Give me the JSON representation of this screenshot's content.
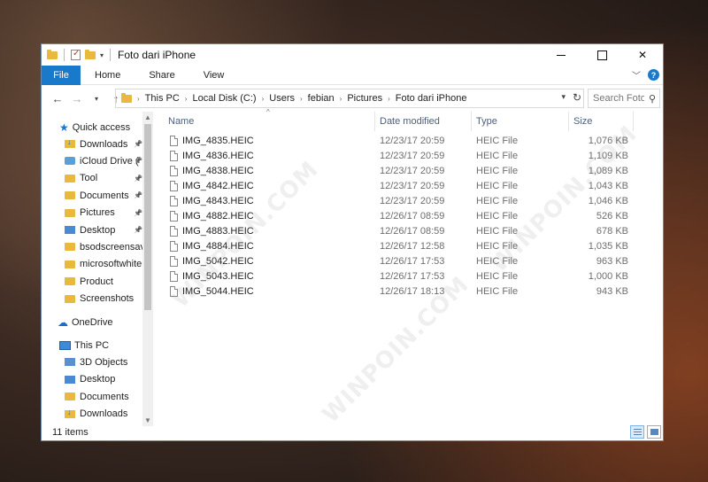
{
  "window": {
    "title": "Foto dari iPhone",
    "quick_access_dropdown": "▾"
  },
  "ribbon": {
    "tabs": [
      "File",
      "Home",
      "Share",
      "View"
    ]
  },
  "address": {
    "crumbs": [
      "This PC",
      "Local Disk (C:)",
      "Users",
      "febian",
      "Pictures",
      "Foto dari iPhone"
    ],
    "search_placeholder": "Search Foto..."
  },
  "nav": {
    "quick_access": "Quick access",
    "quick_items": [
      {
        "label": "Downloads",
        "icon": "downloads-folder-icon",
        "pinned": true
      },
      {
        "label": "iCloud Drive (",
        "icon": "icloud-drive-icon",
        "pinned": true
      },
      {
        "label": "Tool",
        "icon": "folder-icon",
        "pinned": true
      },
      {
        "label": "Documents",
        "icon": "documents-folder-icon",
        "pinned": true
      },
      {
        "label": "Pictures",
        "icon": "pictures-folder-icon",
        "pinned": true
      },
      {
        "label": "Desktop",
        "icon": "desktop-folder-icon",
        "pinned": true
      },
      {
        "label": "bsodscreensaver",
        "icon": "folder-icon",
        "pinned": false
      },
      {
        "label": "microsoftwhiteb",
        "icon": "folder-icon",
        "pinned": false
      },
      {
        "label": "Product",
        "icon": "folder-icon",
        "pinned": false
      },
      {
        "label": "Screenshots",
        "icon": "folder-icon",
        "pinned": false
      }
    ],
    "onedrive": "OneDrive",
    "this_pc": "This PC",
    "pc_items": [
      {
        "label": "3D Objects",
        "icon": "3d-objects-icon"
      },
      {
        "label": "Desktop",
        "icon": "desktop-folder-icon"
      },
      {
        "label": "Documents",
        "icon": "documents-folder-icon"
      },
      {
        "label": "Downloads",
        "icon": "downloads-folder-icon"
      }
    ]
  },
  "columns": {
    "name": "Name",
    "date": "Date modified",
    "type": "Type",
    "size": "Size"
  },
  "files": [
    {
      "name": "IMG_4835.HEIC",
      "date": "12/23/17 20:59",
      "type": "HEIC File",
      "size": "1,076 KB"
    },
    {
      "name": "IMG_4836.HEIC",
      "date": "12/23/17 20:59",
      "type": "HEIC File",
      "size": "1,109 KB"
    },
    {
      "name": "IMG_4838.HEIC",
      "date": "12/23/17 20:59",
      "type": "HEIC File",
      "size": "1,089 KB"
    },
    {
      "name": "IMG_4842.HEIC",
      "date": "12/23/17 20:59",
      "type": "HEIC File",
      "size": "1,043 KB"
    },
    {
      "name": "IMG_4843.HEIC",
      "date": "12/23/17 20:59",
      "type": "HEIC File",
      "size": "1,046 KB"
    },
    {
      "name": "IMG_4882.HEIC",
      "date": "12/26/17 08:59",
      "type": "HEIC File",
      "size": "526 KB"
    },
    {
      "name": "IMG_4883.HEIC",
      "date": "12/26/17 08:59",
      "type": "HEIC File",
      "size": "678 KB"
    },
    {
      "name": "IMG_4884.HEIC",
      "date": "12/26/17 12:58",
      "type": "HEIC File",
      "size": "1,035 KB"
    },
    {
      "name": "IMG_5042.HEIC",
      "date": "12/26/17 17:53",
      "type": "HEIC File",
      "size": "963 KB"
    },
    {
      "name": "IMG_5043.HEIC",
      "date": "12/26/17 17:53",
      "type": "HEIC File",
      "size": "1,000 KB"
    },
    {
      "name": "IMG_5044.HEIC",
      "date": "12/26/17 18:13",
      "type": "HEIC File",
      "size": "943 KB"
    }
  ],
  "status": {
    "item_count": "11 items"
  },
  "watermark": "WINPOIN.COM",
  "colors": {
    "accent": "#1979ca",
    "header_text": "#4c607a"
  }
}
